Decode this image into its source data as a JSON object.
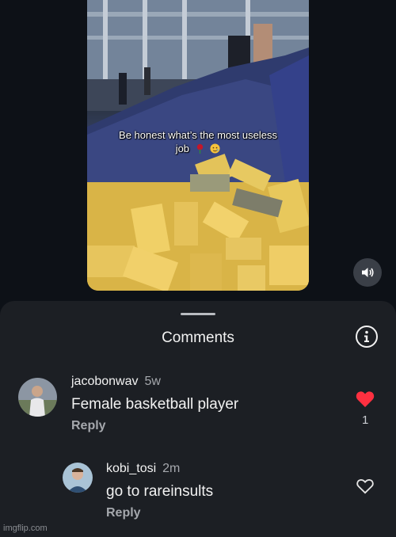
{
  "video": {
    "caption_line1": "Be honest what’s the most useless",
    "caption_line2": "job",
    "emojis": [
      "rose-icon",
      "smiling-face-with-tear-icon"
    ]
  },
  "mute_icon": "speaker-icon",
  "comments_sheet": {
    "title": "Comments",
    "info_icon": "info-icon",
    "comments": [
      {
        "username": "jacobonwav",
        "age": "5w",
        "text": "Female basketball player",
        "reply_label": "Reply",
        "liked": true,
        "like_count": "1",
        "like_color": "#ff3040"
      },
      {
        "username": "kobi_tosi",
        "age": "2m",
        "text": "go to rareinsults",
        "reply_label": "Reply",
        "liked": false,
        "like_count": ""
      }
    ]
  },
  "watermark": "imgflip.com"
}
